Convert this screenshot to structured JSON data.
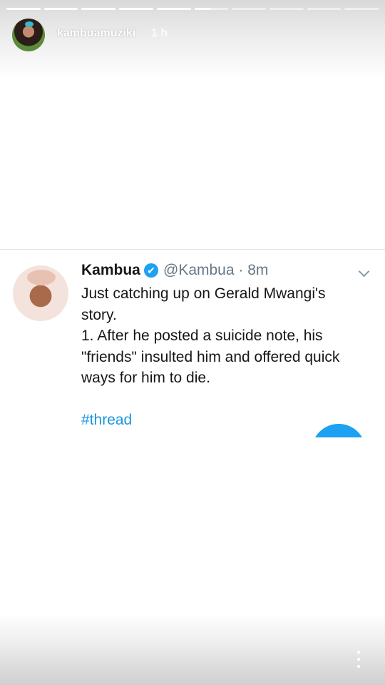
{
  "story": {
    "username": "kambuamuziki",
    "time": "1 h",
    "progress": [
      1,
      1,
      1,
      1,
      1,
      0.5,
      0,
      0,
      0,
      0
    ]
  },
  "tweet": {
    "name": "Kambua",
    "verified": "✔",
    "handle": "@Kambua · 8m",
    "lines": [
      "Just catching up on Gerald Mwangi's",
      "story.",
      "1. After he posted a suicide note, his",
      "\"friends\" insulted him and offered quick",
      "ways for him to die."
    ],
    "hashtag": "#thread"
  },
  "icons": {
    "menu": "more-vertical-icon",
    "chevron": "chevron-down-icon",
    "verified": "verified-badge-icon"
  },
  "colors": {
    "twitter_blue": "#1da1f2",
    "link_blue": "#1b95e0"
  }
}
